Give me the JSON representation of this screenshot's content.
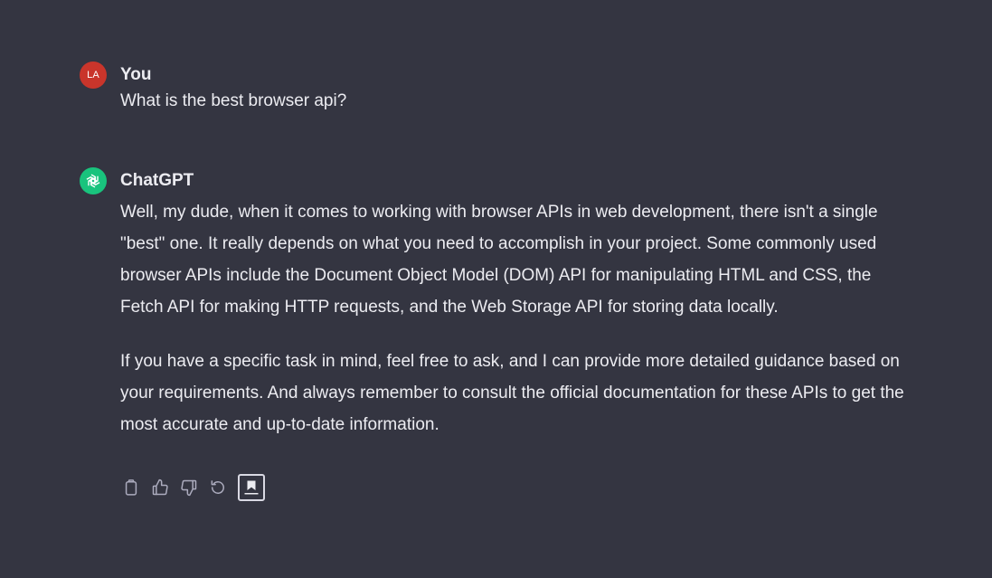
{
  "conversation": {
    "user": {
      "avatar_initials": "LA",
      "avatar_color": "#c9352b",
      "author": "You",
      "message": "What is the best browser api?"
    },
    "assistant": {
      "avatar_icon": "openai-logo-icon",
      "avatar_color": "#19c37d",
      "author": "ChatGPT",
      "paragraphs": [
        "Well, my dude, when it comes to working with browser APIs in web development, there isn't a single \"best\" one. It really depends on what you need to accomplish in your project. Some commonly used browser APIs include the Document Object Model (DOM) API for manipulating HTML and CSS, the Fetch API for making HTTP requests, and the Web Storage API for storing data locally.",
        "If you have a specific task in mind, feel free to ask, and I can provide more detailed guidance based on your requirements. And always remember to consult the official documentation for these APIs to get the most accurate and up-to-date information."
      ]
    },
    "actions": [
      {
        "icon": "clipboard-icon"
      },
      {
        "icon": "thumbs-up-icon"
      },
      {
        "icon": "thumbs-down-icon"
      },
      {
        "icon": "regenerate-icon"
      },
      {
        "icon": "bookmark-icon"
      }
    ]
  },
  "theme": {
    "background": "#343541",
    "text": "#ececf1",
    "icon": "#acacbe"
  }
}
